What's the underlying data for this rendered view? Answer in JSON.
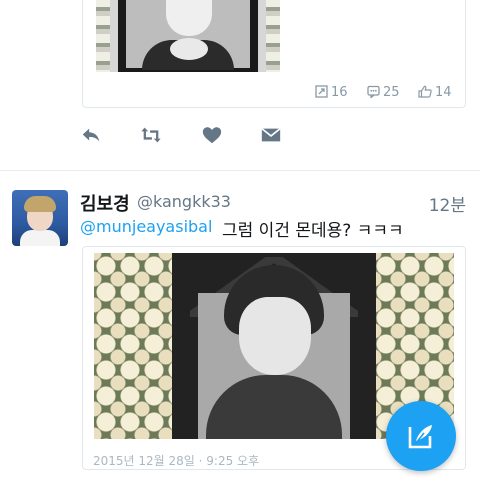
{
  "quoted_tweet": {
    "retweets": "16",
    "replies": "25",
    "likes": "14"
  },
  "actions": {
    "reply": "reply-icon",
    "retweet": "retweet-icon",
    "like": "heart-icon",
    "dm": "envelope-icon"
  },
  "tweet": {
    "name": "김보경",
    "handle": "@kangkk33",
    "time": "12분",
    "mention": "@munjeayasibal",
    "text": "그럼 이건 몬데용? ㅋㅋㅋ",
    "photo_date": "2015년 12월 28일 · 9:25 오후"
  },
  "colors": {
    "accent": "#1da1f2",
    "icon": "#657786",
    "stat_icon": "#8899a6"
  },
  "fab": {
    "icon": "compose-tweet-icon"
  }
}
